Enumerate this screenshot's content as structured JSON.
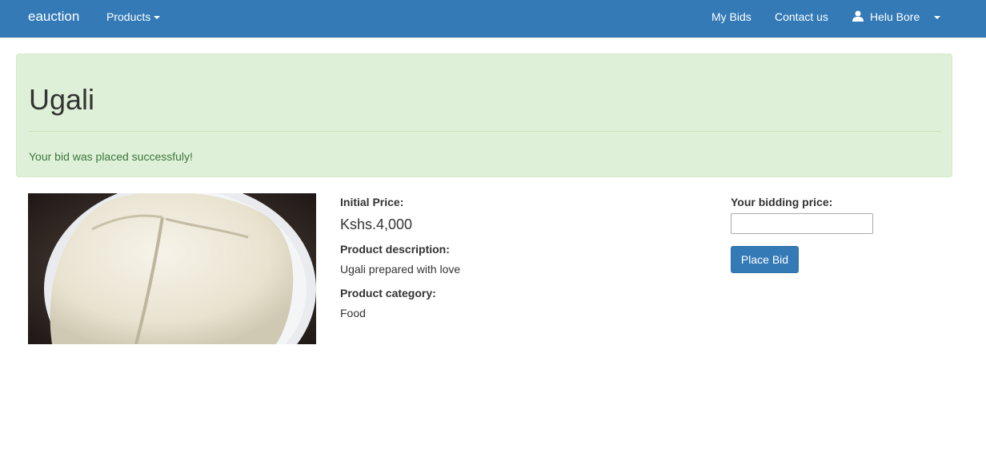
{
  "navbar": {
    "brand": "eauction",
    "products_label": "Products",
    "my_bids_label": "My Bids",
    "contact_label": "Contact us",
    "user_name": "Helu Bore",
    "bg_color": "#337ab7"
  },
  "alert": {
    "title": "Ugali",
    "message": "Your bid was placed successfuly!",
    "bg_color": "#dff0d8"
  },
  "product": {
    "image_alt": "Ugali",
    "initial_price_label": "Initial Price:",
    "initial_price_value": "Kshs.4,000",
    "description_label": "Product description:",
    "description_value": "Ugali prepared with love",
    "category_label": "Product category:",
    "category_value": "Food"
  },
  "bid": {
    "label": "Your bidding price:",
    "input_value": "",
    "button_label": "Place Bid"
  }
}
